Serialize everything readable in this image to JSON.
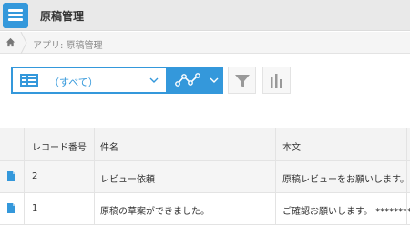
{
  "header": {
    "app_title": "原稿管理",
    "app_icon": "list-app-icon"
  },
  "breadcrumb": {
    "home_icon": "home-icon",
    "text": "アプリ: 原稿管理"
  },
  "toolbar": {
    "view_selected": "（すべて）",
    "view_icon": "table-view-icon",
    "graph_icon": "graph-icon",
    "filter_icon": "filter-icon",
    "chart_icon": "bar-chart-icon",
    "accent": "#3498db"
  },
  "table": {
    "columns": [
      "レコード番号",
      "件名",
      "本文"
    ],
    "rows": [
      {
        "num": "2",
        "subject": "レビュー依頼",
        "body": "原稿レビューをお願いします。 ****"
      },
      {
        "num": "1",
        "subject": "原稿の草案ができました。",
        "body": "ご確認お願いします。 ********"
      }
    ]
  }
}
